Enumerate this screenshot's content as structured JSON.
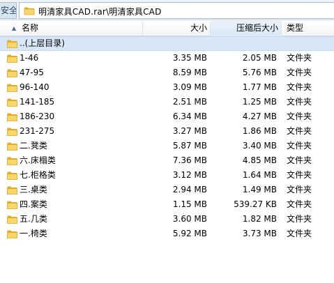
{
  "address": {
    "security_label": "安全",
    "path": "明清家具CAD.rar\\明清家具CAD"
  },
  "columns": {
    "name": "名称",
    "size": "大小",
    "packed": "压缩后大小",
    "type": "类型"
  },
  "parent_row": {
    "name": "..(上层目录)"
  },
  "rows": [
    {
      "name": "1-46",
      "size": "3.35 MB",
      "packed": "2.05 MB",
      "type": "文件夹"
    },
    {
      "name": "47-95",
      "size": "8.59 MB",
      "packed": "5.76 MB",
      "type": "文件夹"
    },
    {
      "name": "96-140",
      "size": "3.09 MB",
      "packed": "1.77 MB",
      "type": "文件夹"
    },
    {
      "name": "141-185",
      "size": "2.51 MB",
      "packed": "1.25 MB",
      "type": "文件夹"
    },
    {
      "name": "186-230",
      "size": "6.34 MB",
      "packed": "4.27 MB",
      "type": "文件夹"
    },
    {
      "name": "231-275",
      "size": "3.27 MB",
      "packed": "1.86 MB",
      "type": "文件夹"
    },
    {
      "name": "二.凳类",
      "size": "5.87 MB",
      "packed": "3.40 MB",
      "type": "文件夹"
    },
    {
      "name": "六.床榻类",
      "size": "7.36 MB",
      "packed": "4.85 MB",
      "type": "文件夹"
    },
    {
      "name": "七.柜格类",
      "size": "3.12 MB",
      "packed": "1.64 MB",
      "type": "文件夹"
    },
    {
      "name": "三.桌类",
      "size": "2.94 MB",
      "packed": "1.49 MB",
      "type": "文件夹"
    },
    {
      "name": "四.案类",
      "size": "1.15 MB",
      "packed": "539.27 KB",
      "type": "文件夹"
    },
    {
      "name": "五.几类",
      "size": "3.60 MB",
      "packed": "1.82 MB",
      "type": "文件夹"
    },
    {
      "name": "一.椅类",
      "size": "5.92 MB",
      "packed": "3.73 MB",
      "type": "文件夹"
    }
  ],
  "icons": {
    "folder": "folder-icon",
    "sort": "sort-arrow-up-icon"
  },
  "colors": {
    "folder": "#f2c64e",
    "selection": "#d9e8f8"
  }
}
